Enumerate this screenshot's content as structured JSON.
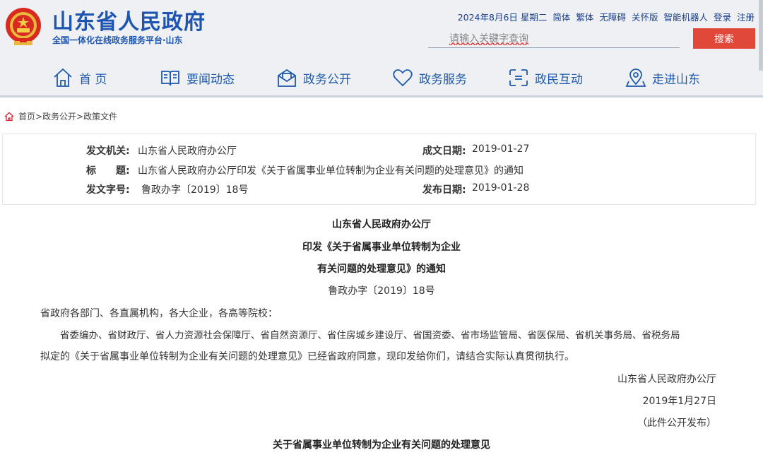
{
  "header": {
    "title": "山东省人民政府",
    "subtitle": "全国一体化在线政务服务平台·山东",
    "top_links": [
      "2024年8月6日 星期二",
      "简体",
      "繁体",
      "无障碍",
      "关怀版",
      "智能机器人",
      "登录",
      "注册"
    ],
    "search_placeholder": "请输入关键字查询",
    "search_button": "搜索"
  },
  "nav": {
    "items": [
      {
        "label": "首 页",
        "icon": "home-icon"
      },
      {
        "label": "要闻动态",
        "icon": "book-icon"
      },
      {
        "label": "政务公开",
        "icon": "mail-icon"
      },
      {
        "label": "政务服务",
        "icon": "heart-icon"
      },
      {
        "label": "政民互动",
        "icon": "interact-icon"
      },
      {
        "label": "走进山东",
        "icon": "location-icon"
      }
    ]
  },
  "breadcrumb": {
    "text": "首页>政务公开>政策文件"
  },
  "info": {
    "issuer_label": "发文机关:",
    "issuer": "山东省人民政府办公厅",
    "date_label": "成文日期:",
    "date": "2019-01-27",
    "title_label": "标　　题:",
    "title": "山东省人民政府办公厅印发《关于省属事业单位转制为企业有关问题的处理意见》的通知",
    "docno_label": "发文字号:",
    "docno": "鲁政办字〔2019〕18号",
    "publish_label": "发布日期:",
    "publish": "2019-01-28"
  },
  "document": {
    "org": "山东省人民政府办公厅",
    "heading_line1": "印发《关于省属事业单位转制为企业",
    "heading_line2": "有关问题的处理意见》的通知",
    "docno": "鲁政办字〔2019〕18号",
    "addressee": "省政府各部门、各直属机构，各大企业，各高等院校：",
    "body_line1": "省委编办、省财政厅、省人力资源社会保障厅、省自然资源厅、省住房城乡建设厅、省国资委、省市场监管局、省医保局、省机关事务局、省税务局",
    "body_line2": "拟定的《关于省属事业单位转制为企业有关问题的处理意见》已经省政府同意，现印发给你们，请结合实际认真贯彻执行。",
    "signature": "山东省人民政府办公厅",
    "sign_date": "2019年1月27日",
    "release_note": "（此件公开发布）",
    "attachment_title": "关于省属事业单位转制为企业有关问题的处理意见"
  },
  "colors": {
    "brand": "#1d55b0",
    "search_button": "#e0483a",
    "header_bg": "#eef0f3"
  }
}
